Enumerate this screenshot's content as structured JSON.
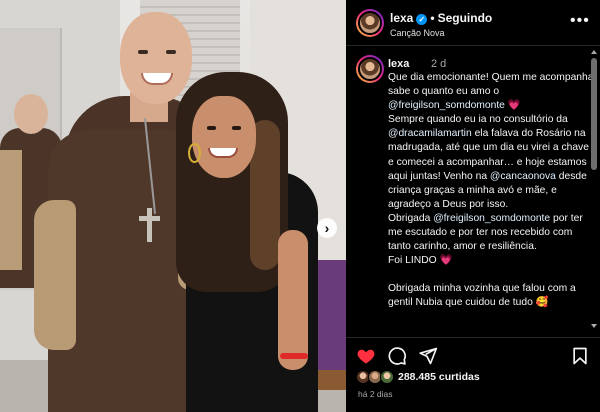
{
  "post": {
    "username": "lexa",
    "verified_mark": "✓",
    "separator": "•",
    "follow_status": "Seguindo",
    "location": "Canção Nova",
    "more_icon": "more-horizontal-icon",
    "next_icon": "chevron-right-icon"
  },
  "caption": {
    "username": "lexa",
    "time": "2 d",
    "lines": [
      "Que dia emocionante! Quem me acompanha sabe o quanto eu amo o ",
      "@freigilson_somdomonte",
      " ",
      "Sempre quando eu ia no consultório da ",
      "@dracamilamartin",
      " ela falava do Rosário na madrugada, até que um dia eu virei a chave e comecei a acompanhar… e hoje estamos aqui juntas! Venho na ",
      "@cancaonova",
      " desde criança graças a minha avó e mãe, e agradeço a Deus por isso.",
      "Obrigada ",
      "@freigilson_somdomonte",
      " por ter me escutado e por ter nos recebido com tanto carinho, amor e resiliência.",
      "Foi LINDO ",
      "Obrigada minha vozinha que falou com a gentil Nubia que cuidou de tudo "
    ],
    "heart_emoji": "💗",
    "face_emoji": "🥰"
  },
  "actions": {
    "like_icon": "heart-filled-icon",
    "comment_icon": "comment-icon",
    "share_icon": "send-icon",
    "save_icon": "bookmark-icon",
    "like_color": "#ff3040"
  },
  "likes": {
    "count_text": "288.485 curtidas"
  },
  "timestamp": "há 2 dias",
  "colors": {
    "background": "#000000",
    "text": "#f5f5f5",
    "secondary": "#a8a8a8",
    "verified": "#0095f6",
    "mention": "#e0f1ff",
    "divider": "#262626"
  }
}
